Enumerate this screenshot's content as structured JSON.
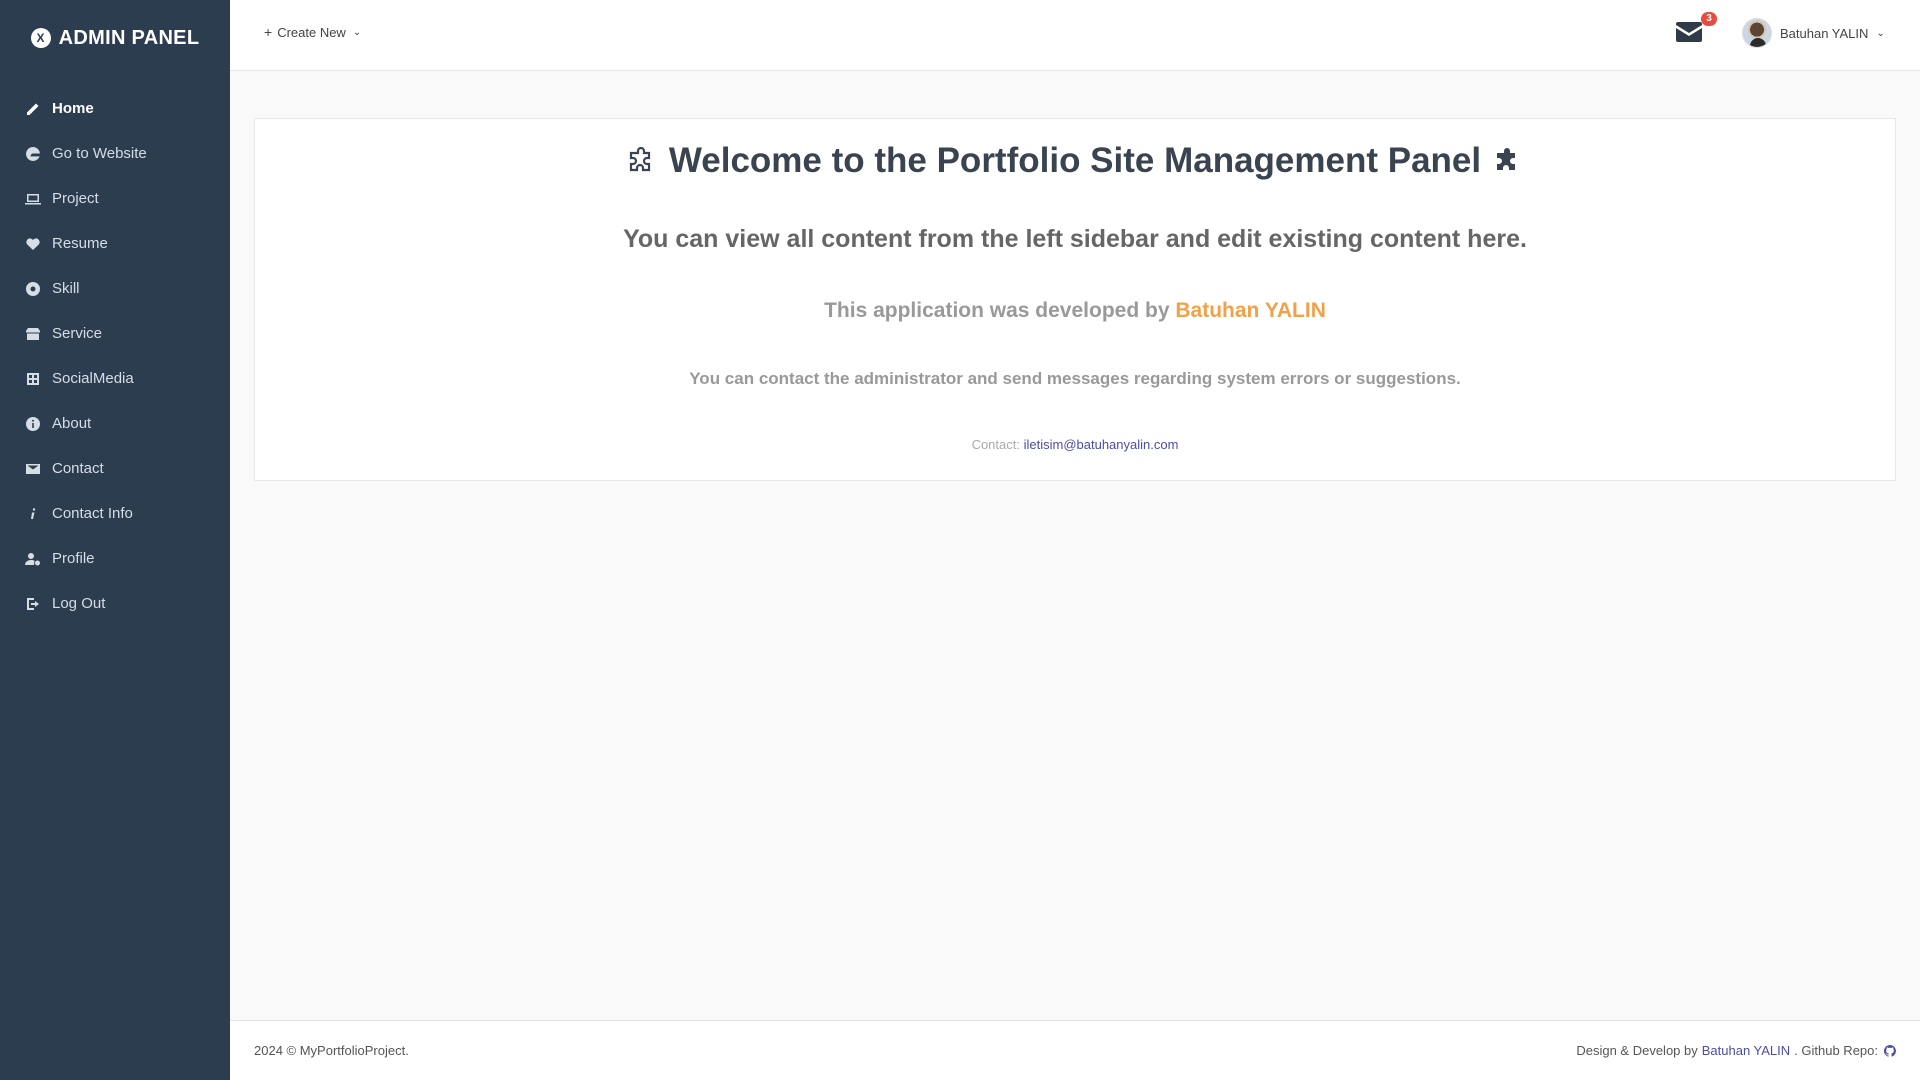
{
  "brand": {
    "title": "ADMIN PANEL",
    "logo_text": "X"
  },
  "sidebar": {
    "items": [
      {
        "label": "Home",
        "icon": "pencil-icon",
        "active": true
      },
      {
        "label": "Go to Website",
        "icon": "edge-icon"
      },
      {
        "label": "Project",
        "icon": "laptop-icon"
      },
      {
        "label": "Resume",
        "icon": "heart-pulse-icon"
      },
      {
        "label": "Skill",
        "icon": "gear-circle-icon"
      },
      {
        "label": "Service",
        "icon": "store-icon"
      },
      {
        "label": "SocialMedia",
        "icon": "grid-icon"
      },
      {
        "label": "About",
        "icon": "info-circle-icon"
      },
      {
        "label": "Contact",
        "icon": "envelope-icon"
      },
      {
        "label": "Contact Info",
        "icon": "italic-i-icon"
      },
      {
        "label": "Profile",
        "icon": "user-gear-icon"
      },
      {
        "label": "Log Out",
        "icon": "logout-icon"
      }
    ]
  },
  "topbar": {
    "create_new": "Create New",
    "mail_count": "3",
    "user_name": "Batuhan YALIN"
  },
  "main": {
    "welcome": "Welcome to the Portfolio Site Management Panel",
    "subtitle": "You can view all content from the left sidebar and edit existing content here.",
    "developed_prefix": "This application was developed by",
    "developer": "Batuhan YALIN",
    "contact_note": "You can contact the administrator and send messages regarding system errors or suggestions.",
    "contact_label": "Contact:",
    "contact_email": "iletisim@batuhanyalin.com"
  },
  "footer": {
    "copyright": "2024 © MyPortfolioProject.",
    "design_prefix": "Design & Develop by",
    "author": "Batuhan YALIN",
    "repo_label": ". Github Repo:"
  },
  "colors": {
    "sidebar_bg": "#2c3d50",
    "accent_orange": "#f0a24b",
    "link_blue": "#4b4fa3",
    "badge_red": "#e74c3c"
  }
}
